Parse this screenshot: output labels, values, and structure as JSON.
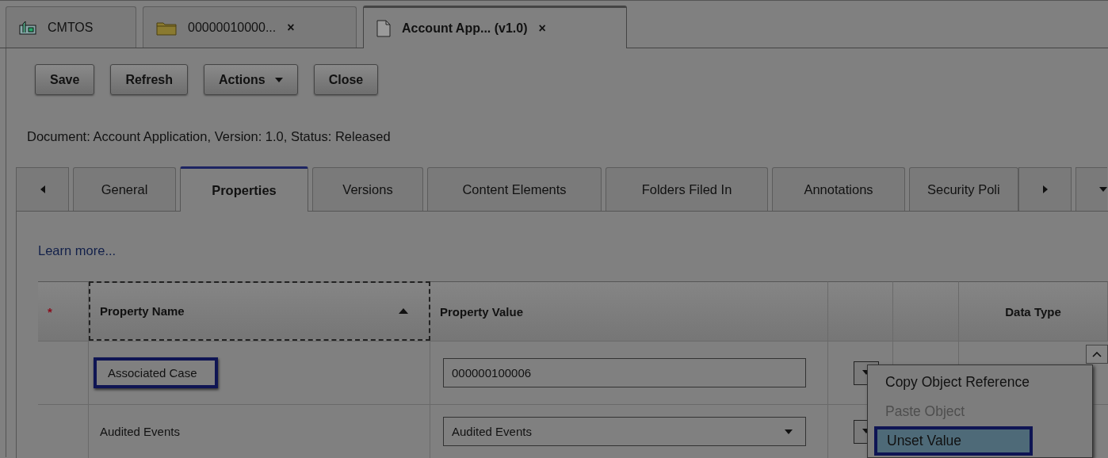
{
  "top_tabs": [
    {
      "label": "CMTOS",
      "closable": false,
      "selected": false
    },
    {
      "label": "00000010000...",
      "closable": true,
      "selected": false
    },
    {
      "label": "Account App... (v1.0)",
      "closable": true,
      "selected": true
    }
  ],
  "close_mark": "×",
  "toolbar": [
    {
      "label": "Save",
      "kind": "button"
    },
    {
      "label": "Refresh",
      "kind": "button"
    },
    {
      "label": "Actions",
      "kind": "menu"
    },
    {
      "label": "Close",
      "kind": "button"
    }
  ],
  "document_info": "Document: Account Application, Version: 1.0, Status: Released",
  "detail_tabs": [
    {
      "label": "General",
      "selected": false
    },
    {
      "label": "Properties",
      "selected": true
    },
    {
      "label": "Versions",
      "selected": false
    },
    {
      "label": "Content Elements",
      "selected": false
    },
    {
      "label": "Folders Filed In",
      "selected": false
    },
    {
      "label": "Annotations",
      "selected": false
    },
    {
      "label": "Security Poli",
      "selected": false
    }
  ],
  "learn_more": "Learn more...",
  "table": {
    "columns": [
      {
        "kind": "required",
        "label": "*",
        "sorted": false
      },
      {
        "kind": "text",
        "label": "Property Name",
        "sorted": true
      },
      {
        "kind": "text",
        "label": "Property Value",
        "sorted": false
      },
      {
        "kind": "blank",
        "sorted": false
      },
      {
        "kind": "blank",
        "sorted": false
      },
      {
        "kind": "text",
        "label": "Data Type",
        "sorted": false
      }
    ],
    "rows": [
      {
        "name": "Associated Case",
        "highlighted": true,
        "value": "000000100006",
        "kind": "text"
      },
      {
        "name": "Audited Events",
        "highlighted": false,
        "value": "Audited Events",
        "kind": "select"
      }
    ]
  },
  "context_menu": {
    "items": [
      {
        "label": "Copy Object Reference",
        "disabled": false,
        "selected": false,
        "highlighted": false
      },
      {
        "label": "Paste Object",
        "disabled": true,
        "selected": false,
        "highlighted": false
      },
      {
        "label": "Unset Value",
        "disabled": false,
        "selected": true,
        "highlighted": true
      }
    ]
  }
}
